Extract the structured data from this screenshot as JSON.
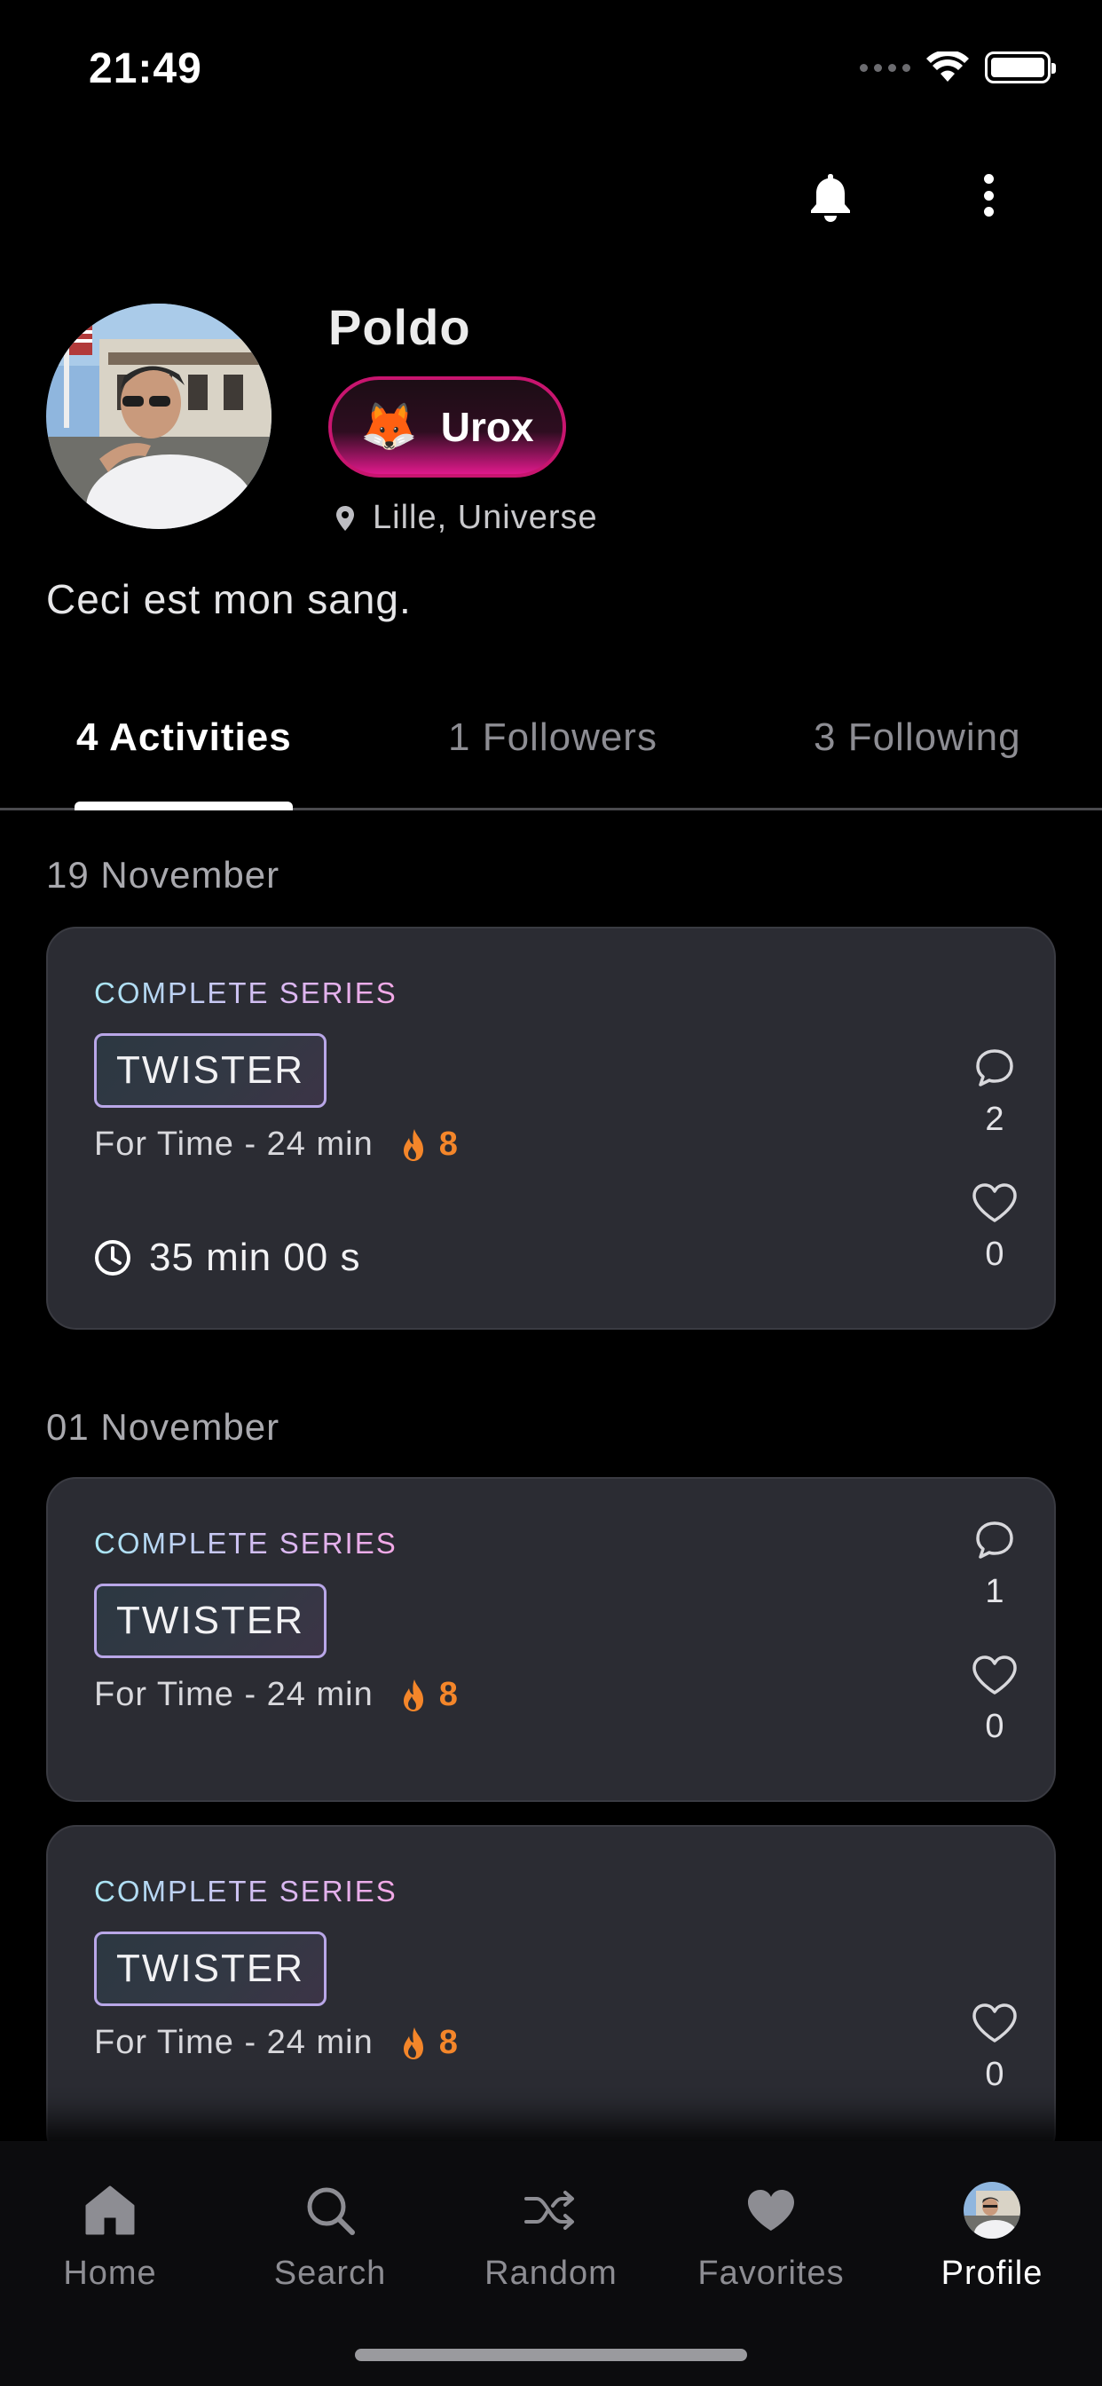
{
  "status_bar": {
    "time": "21:49"
  },
  "profile": {
    "name": "Poldo",
    "team": {
      "emoji": "🦊",
      "label": "Urox"
    },
    "location": "Lille, Universe",
    "bio": "Ceci est mon sang."
  },
  "tabs": [
    {
      "label": "4 Activities",
      "active": true
    },
    {
      "label": "1 Followers",
      "active": false
    },
    {
      "label": "3 Following",
      "active": false
    }
  ],
  "feed": {
    "groups": [
      {
        "date": "19 November",
        "activities": [
          {
            "type": "COMPLETE SERIES",
            "wod": "TWISTER",
            "meta": "For Time - 24 min",
            "intensity": "8",
            "duration": "35 min 00 s",
            "comments": "2",
            "likes": "0"
          }
        ]
      },
      {
        "date": "01 November",
        "activities": [
          {
            "type": "COMPLETE SERIES",
            "wod": "TWISTER",
            "meta": "For Time - 24 min",
            "intensity": "8",
            "comments": "1",
            "likes": "0"
          },
          {
            "type": "COMPLETE SERIES",
            "wod": "TWISTER",
            "meta": "For Time - 24 min",
            "intensity": "8",
            "likes": "0"
          }
        ]
      }
    ]
  },
  "bottom_nav": [
    {
      "label": "Home",
      "icon": "home-icon",
      "active": false
    },
    {
      "label": "Search",
      "icon": "search-icon",
      "active": false
    },
    {
      "label": "Random",
      "icon": "shuffle-icon",
      "active": false
    },
    {
      "label": "Favorites",
      "icon": "heart-icon",
      "active": false
    },
    {
      "label": "Profile",
      "icon": "avatar",
      "active": true
    }
  ],
  "colors": {
    "background": "#000000",
    "card": "#2b2c33",
    "accent_pink": "#e0198c",
    "intensity_orange": "#f4862a",
    "muted_text": "#8d8d93"
  }
}
